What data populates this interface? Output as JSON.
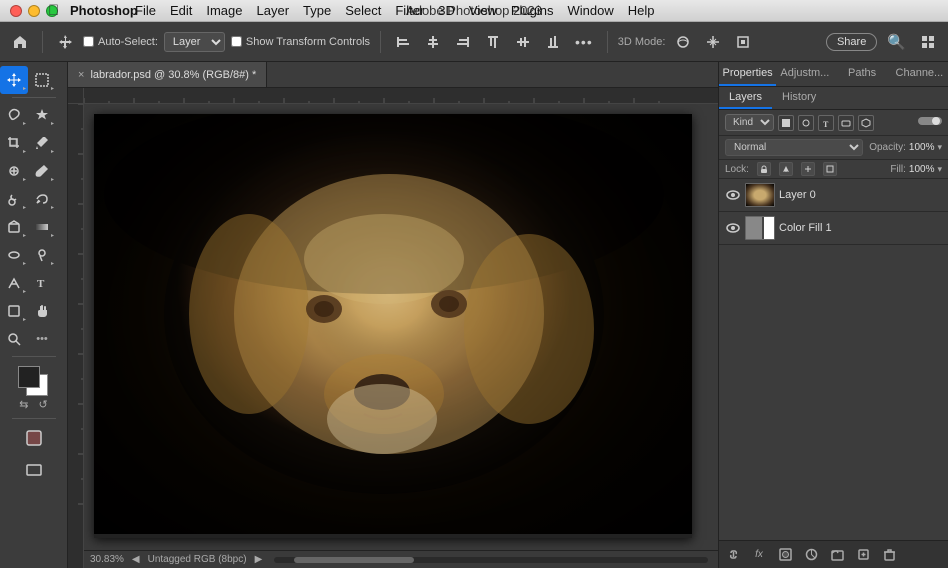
{
  "titlebar": {
    "app_name": "Photoshop",
    "title": "Adobe Photoshop 2023",
    "menu": [
      "File",
      "Edit",
      "Image",
      "Layer",
      "Type",
      "Select",
      "Filter",
      "3D",
      "View",
      "Plugins",
      "Window",
      "Help"
    ]
  },
  "toolbar": {
    "home_icon": "⌂",
    "move_label": "Auto-Select:",
    "layer_select": "Layer",
    "show_transform": "Show Transform Controls",
    "align_icons": [
      "align-left",
      "align-center-h",
      "align-right",
      "align-top",
      "align-center-v",
      "align-bottom"
    ],
    "more_icon": "•••",
    "mode_label": "3D Mode:",
    "share_label": "Share",
    "search_icon": "⌕"
  },
  "doc_tab": {
    "name": "labrador.psd @ 30.8% (RGB/8#) *",
    "close": "×"
  },
  "canvas": {
    "zoom_pct": "30.83%",
    "color_profile": "Untagged RGB (8bpc)"
  },
  "right_panel": {
    "tabs": [
      "Properties",
      "Adjustments",
      "Paths",
      "Channels"
    ],
    "sub_tabs": [
      "Layers",
      "History"
    ]
  },
  "layers": {
    "filter_label": "Kind",
    "blend_mode": "Normal",
    "opacity_label": "Opacity:",
    "opacity_val": "100%",
    "lock_label": "Lock:",
    "fill_label": "Fill:",
    "fill_val": "100%",
    "items": [
      {
        "name": "Layer 0",
        "type": "image",
        "visible": true,
        "selected": false
      },
      {
        "name": "Color Fill 1",
        "type": "fill",
        "visible": true,
        "selected": false
      }
    ]
  },
  "tools": {
    "groups": [
      [
        "move",
        "select-rect"
      ],
      [
        "lasso",
        "magic-wand"
      ],
      [
        "crop",
        "eyedropper-slice"
      ],
      [
        "heal",
        "brush"
      ],
      [
        "clone",
        "history-brush"
      ],
      [
        "eraser",
        "gradient"
      ],
      [
        "blur",
        "dodge"
      ],
      [
        "pen",
        "text"
      ],
      [
        "shape",
        "hand"
      ],
      [
        "zoom",
        "extra"
      ]
    ]
  },
  "layers_footer": {
    "icons": [
      "link",
      "fx",
      "mask",
      "adjustment",
      "folder",
      "new-layer",
      "trash"
    ]
  }
}
